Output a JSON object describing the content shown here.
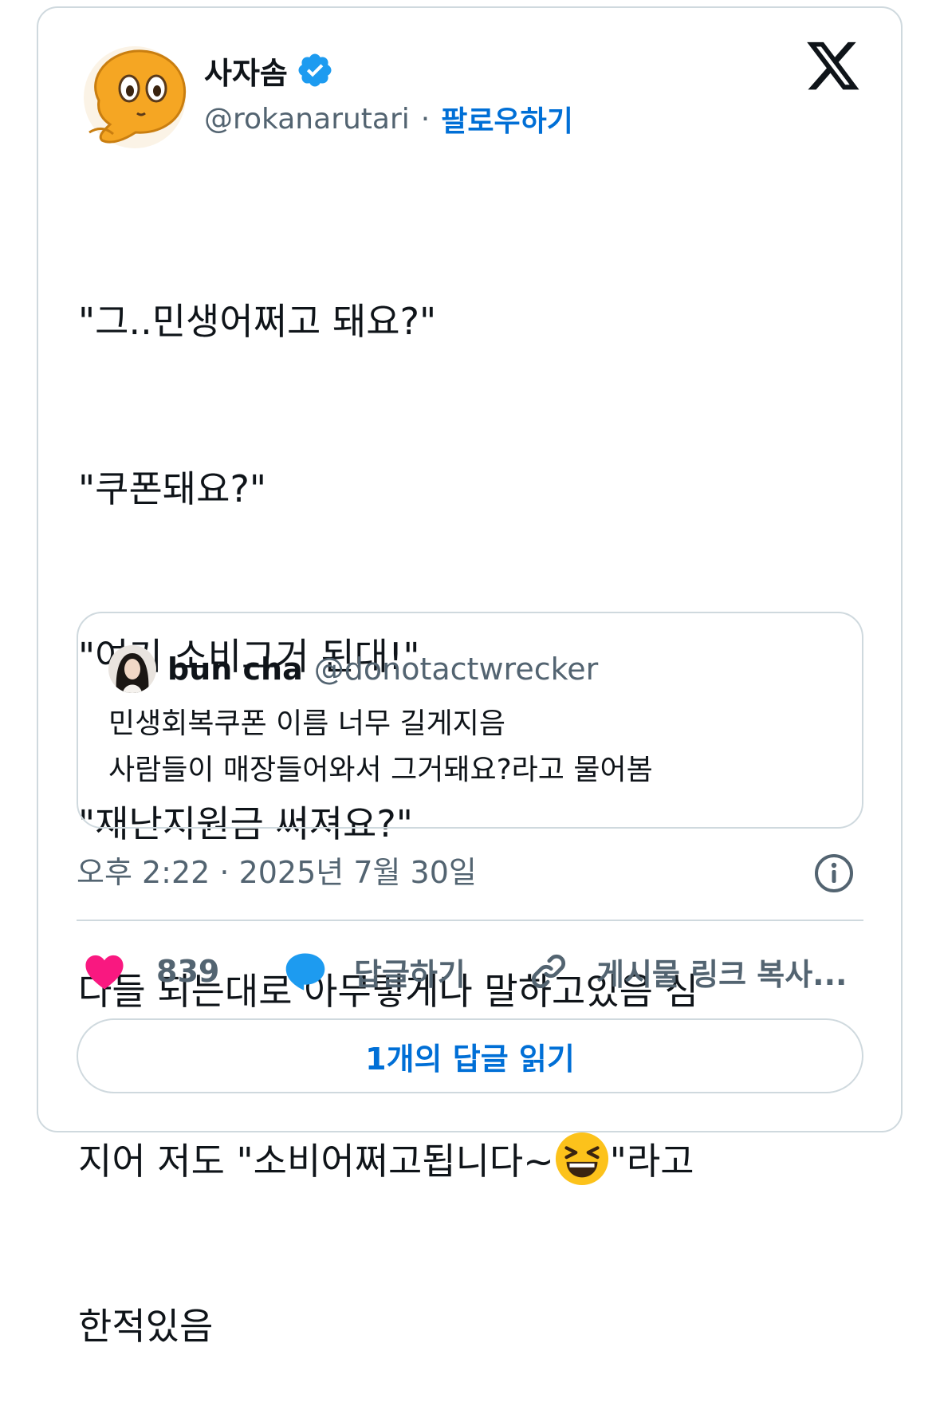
{
  "author": {
    "name": "사자솜",
    "handle": "@rokanarutari",
    "separator": "·",
    "follow_label": "팔로우하기",
    "verified_icon": "verified-badge-icon",
    "avatar_icon": "orange-blob-avatar"
  },
  "brand": {
    "logo_icon": "x-logo-icon"
  },
  "tweet": {
    "lines": [
      "\"그..민생어쩌고 돼요?\"",
      "\"쿠폰돼요?\"",
      "\"여기 소비그거 된대!\"",
      "\"재난지원금 써져요?\"",
      "다들 되는대로 아무렇게나 말하고있음 심",
      "지어 저도 \"소비어쩌고됩니다~",
      "\"라고",
      "한적있음"
    ],
    "emoji_icon": "grinning-squinting-face-emoji"
  },
  "quote": {
    "name": "bun cha",
    "handle": "@donotactwrecker",
    "lines": [
      "민생회복쿠폰 이름 너무 길게지음",
      "사람들이 매장들어와서 그거돼요?라고 물어봄"
    ]
  },
  "meta": {
    "timestamp": "오후 2:22 · 2025년 7월 30일"
  },
  "actions": {
    "like_count": "839",
    "reply_label": "답글하기",
    "copy_label": "게시물 링크 복사..."
  },
  "read_replies_label": "1개의 답글 읽기",
  "colors": {
    "accent": "#006fd6",
    "verified": "#1d9bf0",
    "like": "#f91880",
    "reply": "#1d9bf0",
    "border": "#cfd9de",
    "muted": "#536471",
    "text": "#0f1419"
  }
}
